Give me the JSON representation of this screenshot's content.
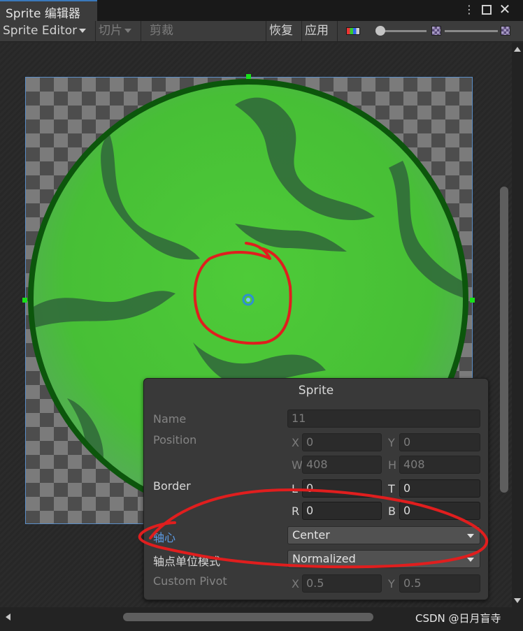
{
  "window": {
    "tab_title": "Sprite 编辑器",
    "menu_glyph": "⋮",
    "close_glyph": "✕"
  },
  "toolbar": {
    "mode_dropdown": "Sprite Editor",
    "slice": "切片",
    "trim": "剪裁",
    "revert": "恢复",
    "apply": "应用"
  },
  "icons": {
    "pivot_handle": "pivot-icon",
    "rgb_toggle": "color-channel-icon",
    "alpha_checker": "checker-icon"
  },
  "colors": {
    "outline_green": "#0c560c",
    "flesh_green": "#4fc73b",
    "stripe_green": "#34703a",
    "annotation_red": "#e01e1e",
    "handle_green": "#19e019"
  },
  "sprite_panel": {
    "title": "Sprite",
    "name_label": "Name",
    "name_value": "11",
    "position_label": "Position",
    "pos_x_axis": "X",
    "pos_x": "0",
    "pos_y_axis": "Y",
    "pos_y": "0",
    "pos_w_axis": "W",
    "pos_w": "408",
    "pos_h_axis": "H",
    "pos_h": "408",
    "border_label": "Border",
    "border_l_axis": "L",
    "border_l": "0",
    "border_t_axis": "T",
    "border_t": "0",
    "border_r_axis": "R",
    "border_r": "0",
    "border_b_axis": "B",
    "border_b": "0",
    "pivot_label": "轴心",
    "pivot_value": "Center",
    "pivot_unit_label": "轴点单位模式",
    "pivot_unit_value": "Normalized",
    "custom_pivot_label": "Custom Pivot",
    "cp_x_axis": "X",
    "cp_x": "0.5",
    "cp_y_axis": "Y",
    "cp_y": "0.5"
  },
  "watermark": "CSDN @日月盲寺"
}
